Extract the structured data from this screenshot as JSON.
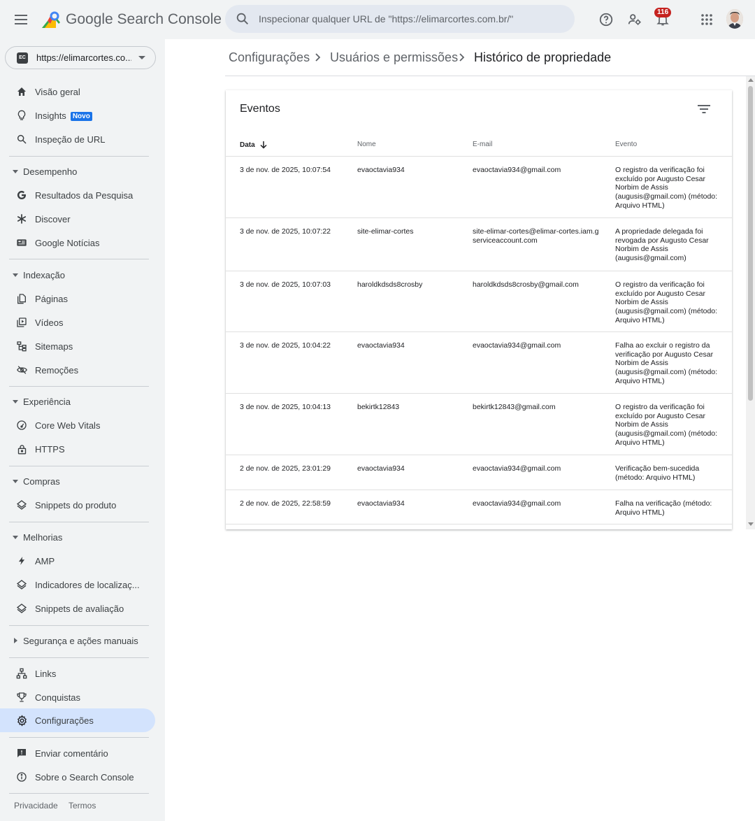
{
  "header": {
    "product_name": "Google Search Console",
    "search_placeholder": "Inspecionar qualquer URL de \"https://elimarcortes.com.br/\"",
    "notification_count": "116",
    "icons": [
      "menu-icon",
      "search-icon",
      "help-icon",
      "manage-users-icon",
      "bell-icon",
      "apps-grid-icon",
      "avatar"
    ]
  },
  "sidebar": {
    "property": {
      "icon_text": "EC",
      "label": "https://elimarcortes.co..."
    },
    "top_items": [
      {
        "label": "Visão geral",
        "icon": "home-icon"
      },
      {
        "label": "Insights",
        "icon": "lightbulb-icon",
        "badge": "Novo"
      },
      {
        "label": "Inspeção de URL",
        "icon": "search-icon"
      }
    ],
    "sections": [
      {
        "title": "Desempenho",
        "expanded": true,
        "items": [
          {
            "label": "Resultados da Pesquisa",
            "icon": "google-g-icon"
          },
          {
            "label": "Discover",
            "icon": "asterisk-icon"
          },
          {
            "label": "Google Notícias",
            "icon": "news-icon"
          }
        ]
      },
      {
        "title": "Indexação",
        "expanded": true,
        "items": [
          {
            "label": "Páginas",
            "icon": "pages-icon"
          },
          {
            "label": "Vídeos",
            "icon": "video-icon"
          },
          {
            "label": "Sitemaps",
            "icon": "sitemap-icon"
          },
          {
            "label": "Remoções",
            "icon": "eye-off-icon"
          }
        ]
      },
      {
        "title": "Experiência",
        "expanded": true,
        "items": [
          {
            "label": "Core Web Vitals",
            "icon": "speed-icon"
          },
          {
            "label": "HTTPS",
            "icon": "lock-icon"
          }
        ]
      },
      {
        "title": "Compras",
        "expanded": true,
        "items": [
          {
            "label": "Snippets do produto",
            "icon": "layers-icon"
          }
        ]
      },
      {
        "title": "Melhorias",
        "expanded": true,
        "items": [
          {
            "label": "AMP",
            "icon": "bolt-icon"
          },
          {
            "label": "Indicadores de localizaç...",
            "icon": "layers-icon"
          },
          {
            "label": "Snippets de avaliação",
            "icon": "layers-icon"
          }
        ]
      },
      {
        "title": "Segurança e ações manuais",
        "expanded": false,
        "items": []
      }
    ],
    "bottom_items": [
      {
        "label": "Links",
        "icon": "links-icon"
      },
      {
        "label": "Conquistas",
        "icon": "trophy-icon"
      },
      {
        "label": "Configurações",
        "icon": "gear-icon",
        "active": true
      }
    ],
    "footer_items": [
      {
        "label": "Enviar comentário",
        "icon": "feedback-icon"
      },
      {
        "label": "Sobre o Search Console",
        "icon": "info-icon"
      }
    ],
    "footer_links": [
      "Privacidade",
      "Termos"
    ]
  },
  "breadcrumb": [
    "Configurações",
    "Usuários e permissões",
    "Histórico de propriedade"
  ],
  "events_card": {
    "title": "Eventos",
    "columns": {
      "date": "Data",
      "name": "Nome",
      "email": "E-mail",
      "event": "Evento"
    },
    "rows": [
      {
        "date": "3 de nov. de 2025, 10:07:54",
        "name": "evaoctavia934",
        "email": "evaoctavia934@gmail.com",
        "event": "O registro da verificação foi excluído por Augusto Cesar Norbim de Assis (augusis@gmail.com) (método: Arquivo HTML)"
      },
      {
        "date": "3 de nov. de 2025, 10:07:22",
        "name": "site-elimar-cortes",
        "email": "site-elimar-cortes@elimar-cortes.iam.gserviceaccount.com",
        "event": "A propriedade delegada foi revogada por Augusto Cesar Norbim de Assis (augusis@gmail.com)"
      },
      {
        "date": "3 de nov. de 2025, 10:07:03",
        "name": "haroldkdsds8crosby",
        "email": "haroldkdsds8crosby@gmail.com",
        "event": "O registro da verificação foi excluído por Augusto Cesar Norbim de Assis (augusis@gmail.com) (método: Arquivo HTML)"
      },
      {
        "date": "3 de nov. de 2025, 10:04:22",
        "name": "evaoctavia934",
        "email": "evaoctavia934@gmail.com",
        "event": "Falha ao excluir o registro da verificação por Augusto Cesar Norbim de Assis (augusis@gmail.com) (método: Arquivo HTML)"
      },
      {
        "date": "3 de nov. de 2025, 10:04:13",
        "name": "bekirtk12843",
        "email": "bekirtk12843@gmail.com",
        "event": "O registro da verificação foi excluído por Augusto Cesar Norbim de Assis (augusis@gmail.com) (método: Arquivo HTML)"
      },
      {
        "date": "2 de nov. de 2025, 23:01:29",
        "name": "evaoctavia934",
        "email": "evaoctavia934@gmail.com",
        "event": "Verificação bem-sucedida (método: Arquivo HTML)"
      },
      {
        "date": "2 de nov. de 2025, 22:58:59",
        "name": "evaoctavia934",
        "email": "evaoctavia934@gmail.com",
        "event": "Falha na verificação (método: Arquivo HTML)"
      }
    ]
  },
  "colors": {
    "sidebar_bg": "#f1f3f4",
    "active_nav": "#d3e3fd",
    "accent": "#1a73e8",
    "badge": "#c5221f"
  }
}
